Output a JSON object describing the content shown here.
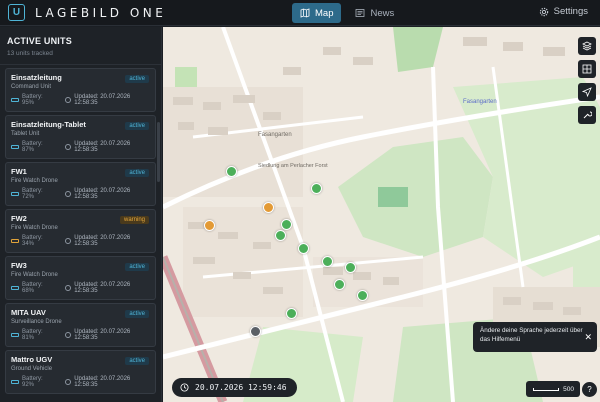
{
  "app": {
    "logo_text": "U",
    "title": "LAGEBILD ONE"
  },
  "nav": {
    "map_label": "Map",
    "news_label": "News",
    "settings_label": "Settings"
  },
  "sidebar": {
    "title": "ACTIVE UNITS",
    "subtitle": "13 units tracked",
    "units": [
      {
        "name": "Einsatzleitung",
        "type": "Command Unit",
        "battery": "Battery: 95%",
        "updated": "Updated: 20.07.2026 12:58:35",
        "status": "active"
      },
      {
        "name": "Einsatzleitung-Tablet",
        "type": "Tablet Unit",
        "battery": "Battery: 87%",
        "updated": "Updated: 20.07.2026 12:58:35",
        "status": "active"
      },
      {
        "name": "FW1",
        "type": "Fire Watch Drone",
        "battery": "Battery: 72%",
        "updated": "Updated: 20.07.2026 12:58:35",
        "status": "active"
      },
      {
        "name": "FW2",
        "type": "Fire Watch Drone",
        "battery": "Battery: 34%",
        "updated": "Updated: 20.07.2026 12:58:35",
        "status": "warning"
      },
      {
        "name": "FW3",
        "type": "Fire Watch Drone",
        "battery": "Battery: 68%",
        "updated": "Updated: 20.07.2026 12:58:35",
        "status": "active"
      },
      {
        "name": "MITA UAV",
        "type": "Surveillance Drone",
        "battery": "Battery: 81%",
        "updated": "Updated: 20.07.2026 12:58:35",
        "status": "active"
      },
      {
        "name": "Mattro UGV",
        "type": "Ground Vehicle",
        "battery": "Battery: 92%",
        "updated": "Updated: 20.07.2026 12:58:35",
        "status": "active"
      }
    ]
  },
  "map": {
    "labels": {
      "fasangarten_1": "Fasangarten",
      "fasangarten_2": "Fasangarten",
      "siedlung": "Siedlung am Perlacher Forst"
    },
    "datetime": "20.07.2026 12:59:46",
    "toast_text": "Ändere deine Sprache jederzeit über das Hilfemenü",
    "toast_close": "✕",
    "scale_value": "500",
    "help": "?"
  },
  "colors": {
    "accent": "#2d6a8a",
    "active": "#4fb4d6",
    "warning": "#e6a83c",
    "marker_green": "#4caf5a",
    "marker_orange": "#e39a35",
    "marker_gray": "#5a5f66"
  }
}
